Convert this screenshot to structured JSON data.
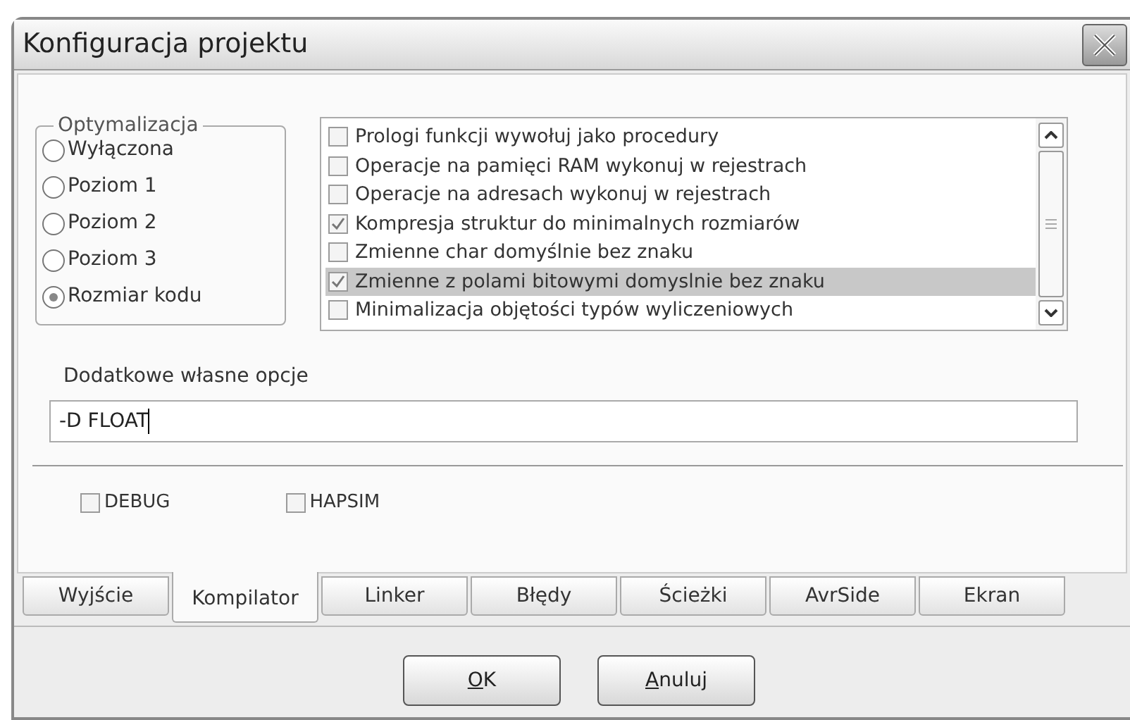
{
  "window": {
    "title": "Konfiguracja projektu"
  },
  "optimization": {
    "legend": "Optymalizacja",
    "options": [
      {
        "label": "Wyłączona",
        "selected": false
      },
      {
        "label": "Poziom 1",
        "selected": false
      },
      {
        "label": "Poziom 2",
        "selected": false
      },
      {
        "label": "Poziom 3",
        "selected": false
      },
      {
        "label": "Rozmiar kodu",
        "selected": true
      }
    ]
  },
  "options_list": [
    {
      "label": "Prologi funkcji wywołuj jako procedury",
      "checked": false,
      "selected": false
    },
    {
      "label": "Operacje na pamięci RAM wykonuj w rejestrach",
      "checked": false,
      "selected": false
    },
    {
      "label": "Operacje na adresach wykonuj w rejestrach",
      "checked": false,
      "selected": false
    },
    {
      "label": "Kompresja struktur do minimalnych rozmiarów",
      "checked": true,
      "selected": false
    },
    {
      "label": "Zmienne char domyślnie bez znaku",
      "checked": false,
      "selected": false
    },
    {
      "label": "Zmienne z polami bitowymi domyslnie bez znaku",
      "checked": true,
      "selected": true
    },
    {
      "label": "Minimalizacja objętości typów wyliczeniowych",
      "checked": false,
      "selected": false
    }
  ],
  "extra_options": {
    "label": "Dodatkowe własne opcje",
    "value": "-D FLOAT",
    "focused": true
  },
  "flags": [
    {
      "label": "DEBUG",
      "checked": false
    },
    {
      "label": "HAPSIM",
      "checked": false
    }
  ],
  "tabs": [
    {
      "label": "Wyjście",
      "selected": false
    },
    {
      "label": "Kompilator",
      "selected": true
    },
    {
      "label": "Linker",
      "selected": false
    },
    {
      "label": "Błędy",
      "selected": false
    },
    {
      "label": "Ścieżki",
      "selected": false
    },
    {
      "label": "AvrSide",
      "selected": false
    },
    {
      "label": "Ekran",
      "selected": false
    }
  ],
  "buttons": [
    {
      "label": "OK"
    },
    {
      "label": "Anuluj"
    }
  ]
}
